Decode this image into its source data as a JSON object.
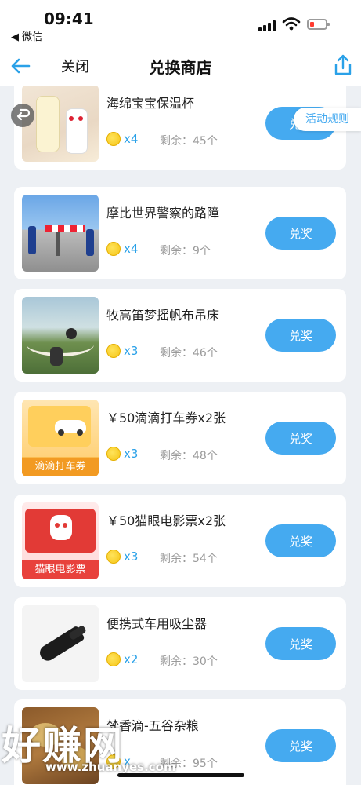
{
  "status_bar": {
    "time": "09:41",
    "back_app": "◀ 微信"
  },
  "nav": {
    "close_label": "关闭",
    "title": "兑换商店"
  },
  "rules_label": "活动规则",
  "redeem_label": "兑奖",
  "remain_prefix": "剩余：",
  "items": [
    {
      "title": "海绵宝宝保温杯",
      "cost": "x4",
      "remain": "45个"
    },
    {
      "title": "摩比世界警察的路障",
      "cost": "x4",
      "remain": "9个"
    },
    {
      "title": "牧高笛梦摇帆布吊床",
      "cost": "x3",
      "remain": "46个"
    },
    {
      "title": "￥50滴滴打车券x2张",
      "cost": "x3",
      "remain": "48个",
      "thumb_label": "滴滴打车券"
    },
    {
      "title": "￥50猫眼电影票x2张",
      "cost": "x3",
      "remain": "54个",
      "thumb_label": "猫眼电影票"
    },
    {
      "title": "便携式车用吸尘器",
      "cost": "x2",
      "remain": "30个"
    },
    {
      "title": "梵香滴-五谷杂粮",
      "cost": "x",
      "remain": "95个"
    }
  ],
  "watermark": {
    "text": "好赚网",
    "url": "www.zhuanyes.com"
  },
  "colors": {
    "accent": "#45aaf0",
    "count_text": "#2aa1e8",
    "background": "#edf0f4"
  }
}
